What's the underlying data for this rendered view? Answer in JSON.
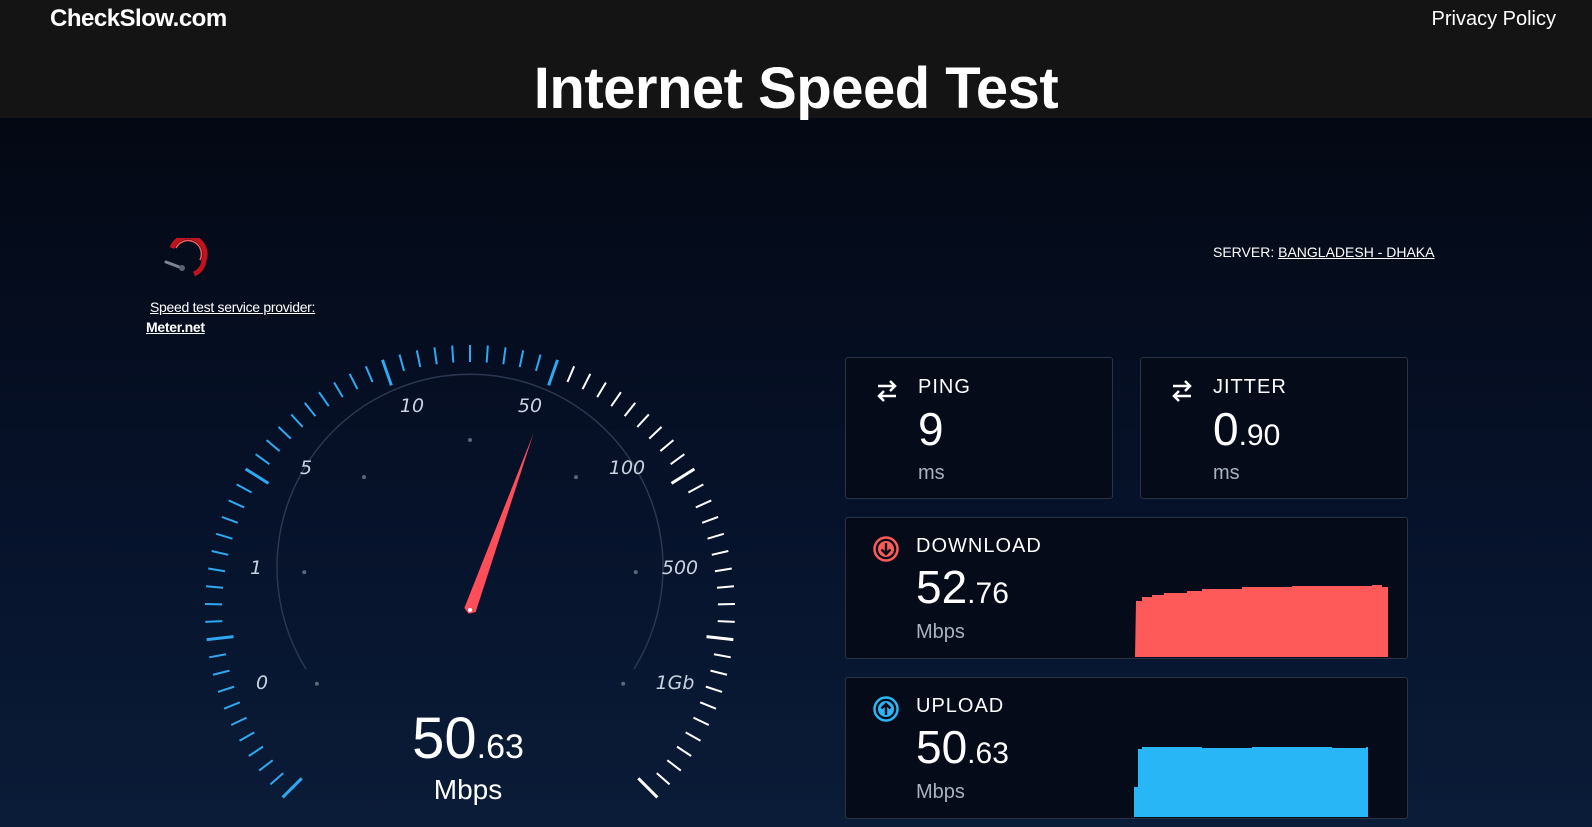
{
  "header": {
    "brand": "CheckSlow.com",
    "privacy_link": "Privacy Policy",
    "title": "Internet Speed Test"
  },
  "provider": {
    "caption": "Speed test service provider:",
    "link": "Meter.net"
  },
  "server": {
    "label": "SERVER: ",
    "value": "BANGLADESH - DHAKA"
  },
  "gauge": {
    "tick_labels": [
      "0",
      "1",
      "5",
      "10",
      "50",
      "100",
      "500",
      "1Gb"
    ],
    "needle_value_mbps": 50.63,
    "readout_int": "50",
    "readout_dec": ".63",
    "unit": "Mbps",
    "colors": {
      "active": "#2ea8f0",
      "inactive": "#ffffff",
      "needle": "#ff4d5a"
    }
  },
  "ping": {
    "label": "PING",
    "value_int": "9",
    "value_dec": "",
    "unit": "ms",
    "icon": "swap-arrows-icon"
  },
  "jitter": {
    "label": "JITTER",
    "value_int": "0",
    "value_dec": ".90",
    "unit": "ms",
    "icon": "swap-arrows-icon"
  },
  "download": {
    "label": "DOWNLOAD",
    "value_int": "52",
    "value_dec": ".76",
    "unit": "Mbps",
    "icon": "download-arrow-icon",
    "color": "#ff5a5a"
  },
  "upload": {
    "label": "UPLOAD",
    "value_int": "50",
    "value_dec": ".63",
    "unit": "Mbps",
    "icon": "upload-arrow-icon",
    "color": "#29b6f6"
  }
}
